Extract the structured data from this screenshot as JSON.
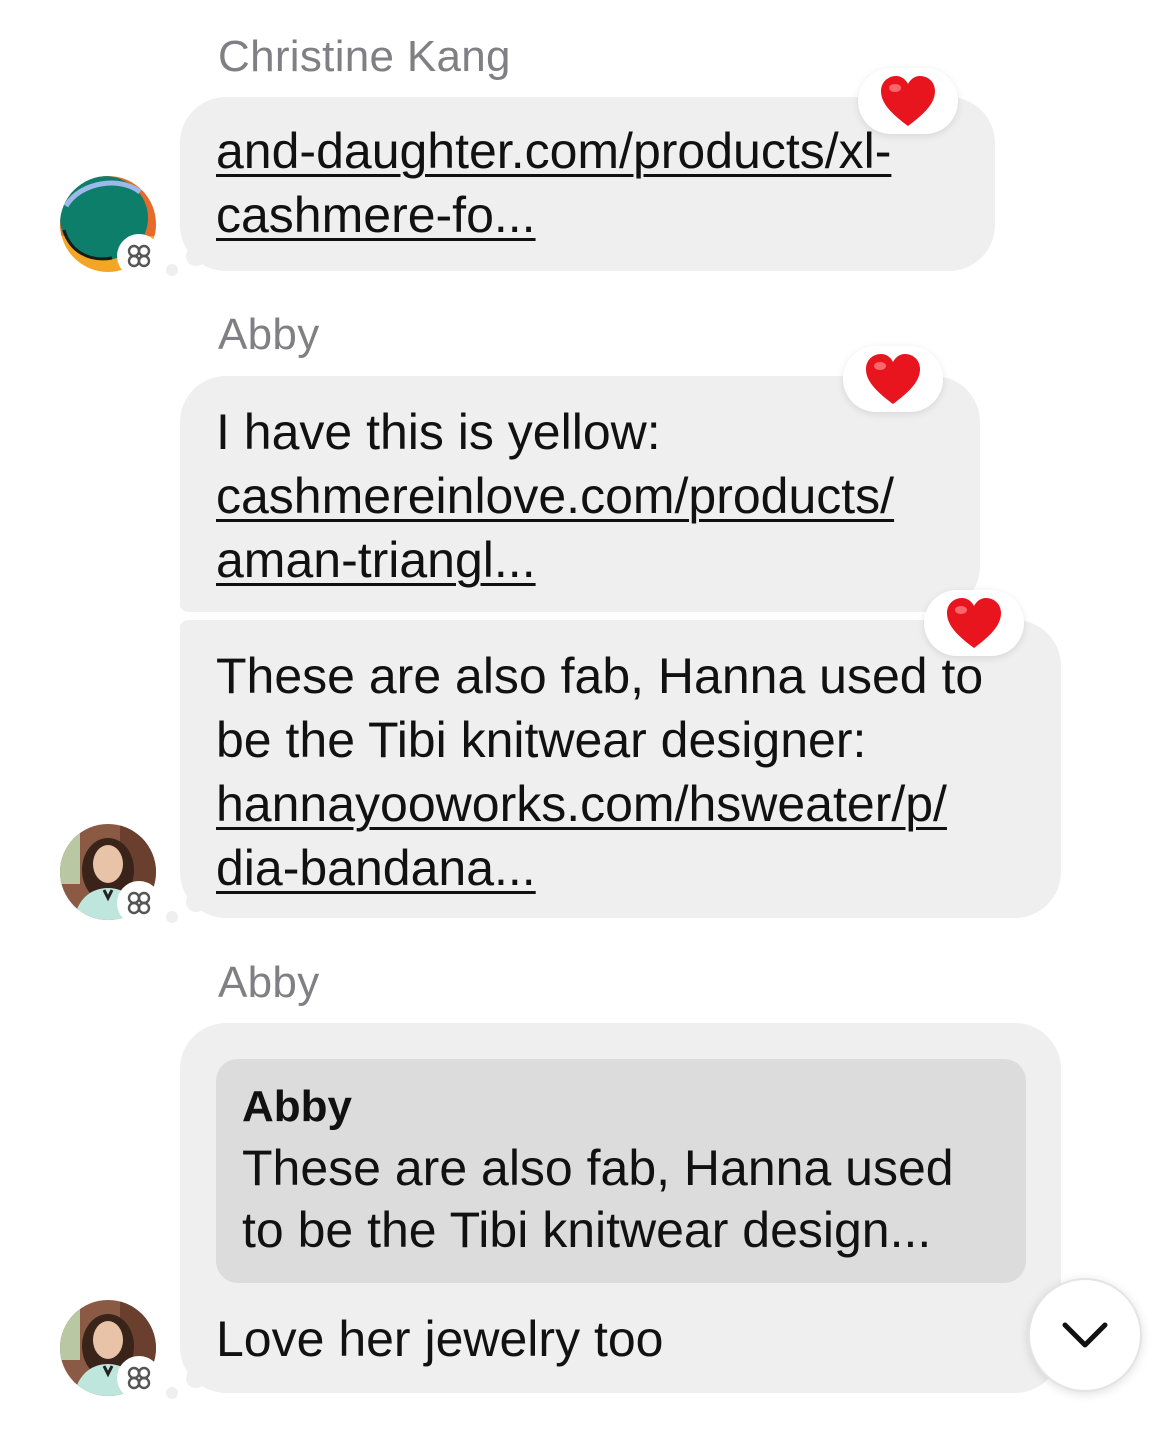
{
  "messages": [
    {
      "sender": "Christine Kang",
      "lines": [
        "and-daughter.com/products/xl-",
        "cashmere-fo..."
      ],
      "reaction": "heart"
    },
    {
      "sender": "Abby",
      "text_line": "I have this is yellow:",
      "link_lines": [
        "cashmereinlove.com/products/",
        "aman-triangl..."
      ],
      "reaction": "heart"
    },
    {
      "text_lines": [
        "These are also fab, Hanna used to",
        "be the Tibi knitwear designer:"
      ],
      "link_lines": [
        "hannayooworks.com/hsweater/p/",
        "dia-bandana..."
      ],
      "reaction": "heart"
    },
    {
      "sender": "Abby",
      "reply_to": {
        "name": "Abby",
        "lines": [
          "These are also fab, Hanna used",
          "to be the Tibi knitwear design..."
        ]
      },
      "text": "Love her jewelry too"
    }
  ],
  "icons": {
    "reaction": "heart-icon",
    "group": "group-badge-icon",
    "scroll": "chevron-down-icon"
  },
  "colors": {
    "bubble": "#efefef",
    "sender": "#7f7f84",
    "heart": "#e8141e",
    "quote": "#dcdcdc"
  }
}
